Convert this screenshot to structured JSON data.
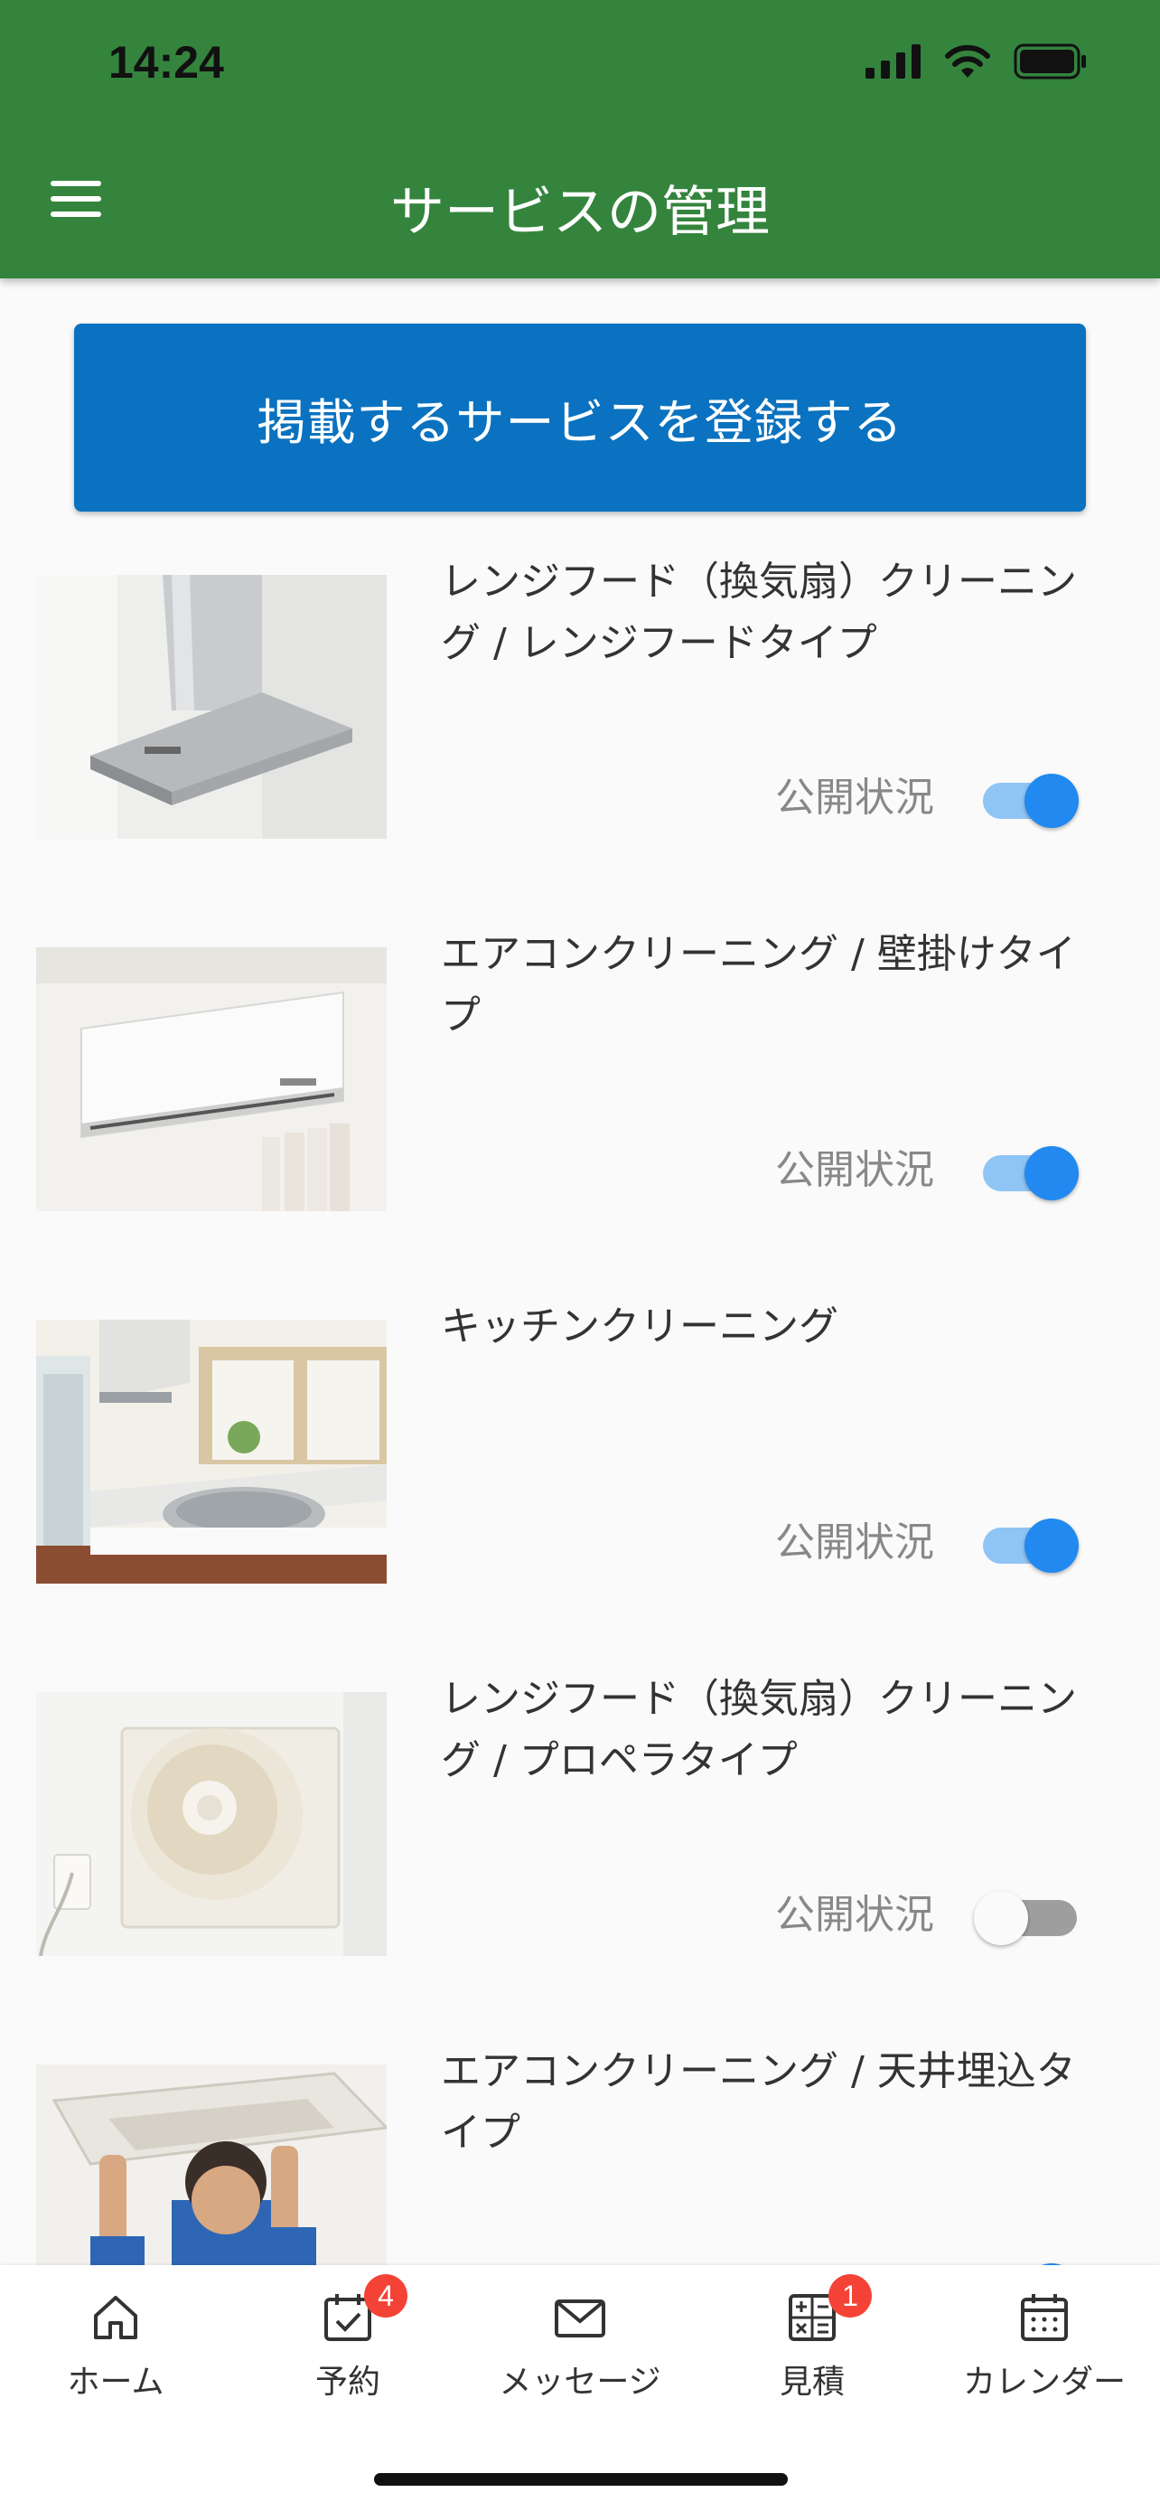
{
  "status_bar": {
    "time": "14:24"
  },
  "header": {
    "title": "サービスの管理"
  },
  "register_button": {
    "label": "掲載するサービスを登録する"
  },
  "services": [
    {
      "title": "レンジフード（換気扇）クリーニング / レンジフードタイプ",
      "status_label": "公開状況",
      "published": true,
      "image": "range-hood-image"
    },
    {
      "title": "エアコンクリーニング / 壁掛けタイプ",
      "status_label": "公開状況",
      "published": true,
      "image": "wall-air-conditioner-image"
    },
    {
      "title": "キッチンクリーニング",
      "status_label": "公開状況",
      "published": true,
      "image": "kitchen-image"
    },
    {
      "title": "レンジフード（換気扇）クリーニング / プロペラタイプ",
      "status_label": "公開状況",
      "published": false,
      "image": "propeller-fan-image"
    },
    {
      "title": "エアコンクリーニング / 天井埋込タイプ",
      "status_label": "公開状況",
      "published": true,
      "image": "ceiling-air-conditioner-image"
    }
  ],
  "bottom_nav": [
    {
      "label": "ホーム",
      "icon": "home-icon",
      "badge": ""
    },
    {
      "label": "予約",
      "icon": "calendar-check-icon",
      "badge": "4"
    },
    {
      "label": "メッセージ",
      "icon": "mail-icon",
      "badge": ""
    },
    {
      "label": "見積",
      "icon": "calculator-icon",
      "badge": "1"
    },
    {
      "label": "カレンダー",
      "icon": "calendar-icon",
      "badge": ""
    }
  ],
  "colors": {
    "header": "#34843d",
    "primary_button": "#0a72c0",
    "toggle_on": "#2189f0",
    "badge": "#f44336"
  }
}
